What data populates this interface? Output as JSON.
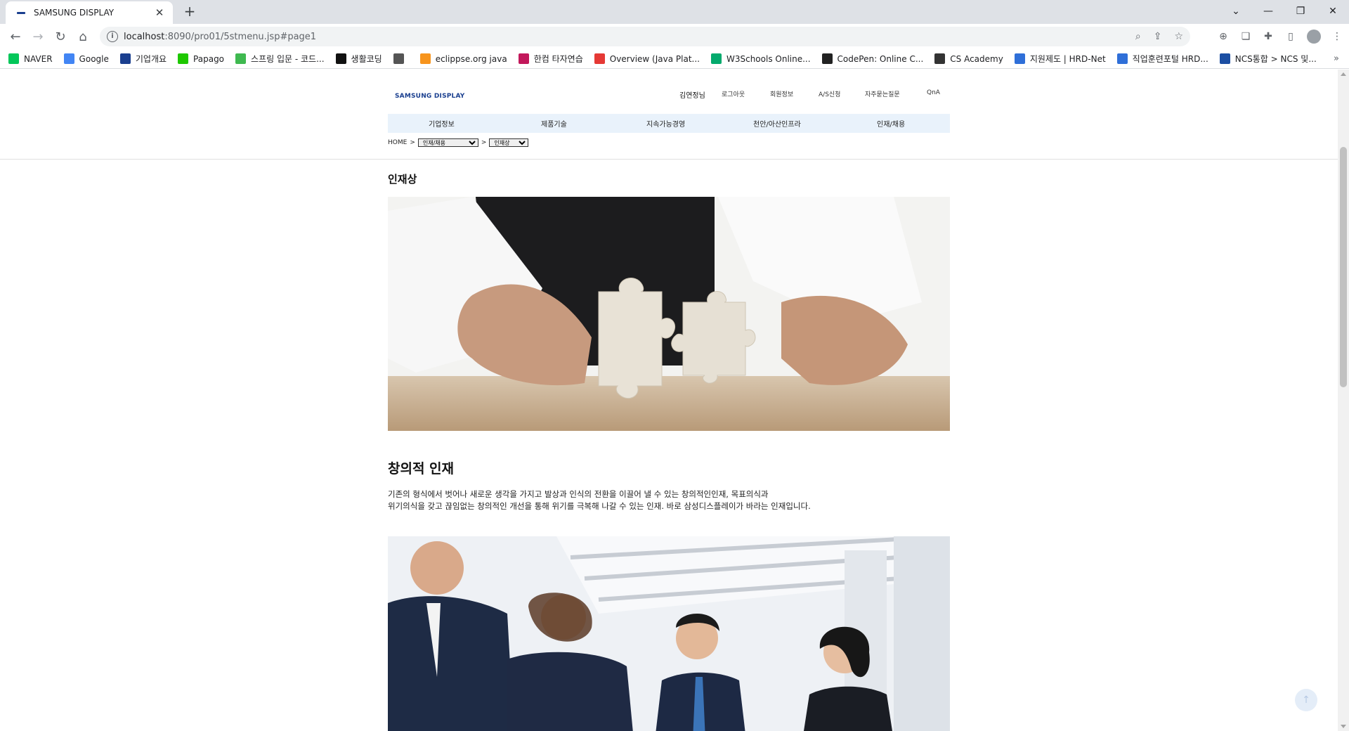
{
  "browser": {
    "tab_title": "SAMSUNG DISPLAY",
    "new_tab": "+",
    "url_host": "localhost",
    "url_rest": ":8090/pro01/5stmenu.jsp#page1",
    "bookmarks": [
      {
        "label": "NAVER",
        "color": "#03c75a"
      },
      {
        "label": "Google",
        "color": "#4285f4"
      },
      {
        "label": "기업개요",
        "color": "#1a3f8f"
      },
      {
        "label": "Papago",
        "color": "#1ec800"
      },
      {
        "label": "스프링 입문 - 코드...",
        "color": "#3fb950"
      },
      {
        "label": "생활코딩",
        "color": "#111111"
      },
      {
        "label": "",
        "color": "#555555"
      },
      {
        "label": "eclippse.org java",
        "color": "#f7941d"
      },
      {
        "label": "한컴 타자연습",
        "color": "#c2185b"
      },
      {
        "label": "Overview (Java Plat...",
        "color": "#e53935"
      },
      {
        "label": "W3Schools Online...",
        "color": "#04aa6d"
      },
      {
        "label": "CodePen: Online C...",
        "color": "#222222"
      },
      {
        "label": "CS Academy",
        "color": "#333333"
      },
      {
        "label": "지원제도 | HRD-Net",
        "color": "#2f6fd8"
      },
      {
        "label": "직업훈련포털 HRD...",
        "color": "#2f6fd8"
      },
      {
        "label": "NCS통합 > NCS 및...",
        "color": "#1c4fa3"
      }
    ]
  },
  "site": {
    "logo": "SAMSUNG DISPLAY",
    "user": "김연정님",
    "util_links": [
      "로그아웃",
      "회원정보",
      "A/S신청",
      "자주묻는질문",
      "QnA"
    ],
    "gnb": [
      "기업정보",
      "제품기술",
      "지속가능경영",
      "천안/아산인프라",
      "인재/채용"
    ],
    "breadcrumb": {
      "home": "HOME",
      "sep": ">",
      "select1": "인재/채용",
      "select2": "인재상"
    },
    "section_title": "인재상",
    "heading": "창의적 인재",
    "desc_line1": "기존의 형식에서 벗어나 새로운 생각을 가지고 발상과 인식의 전환을 이끌어 낼 수 있는 창의적인인재, 목표의식과",
    "desc_line2": "위기의식을 갖고 끊임없는 창의적인 개선을 통해 위기를 극복해 나갈 수 있는 인재. 바로 삼성디스플레이가 바라는 인재입니다.",
    "top_button": "↑"
  }
}
